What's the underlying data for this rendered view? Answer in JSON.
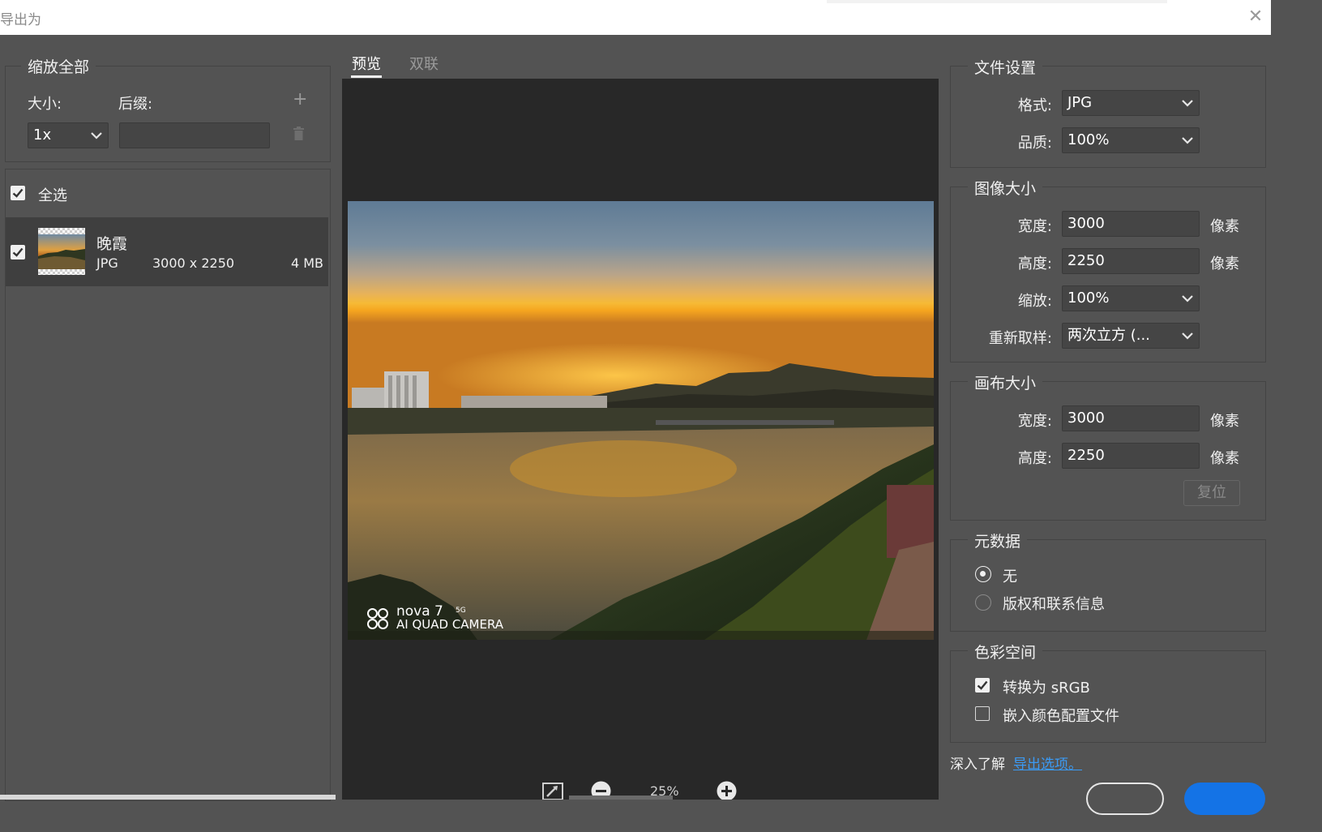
{
  "window": {
    "title": "导出为",
    "close_glyph": "✕"
  },
  "left": {
    "scale_all_title": "缩放全部",
    "size_label": "大小:",
    "suffix_label": "后缀:",
    "size_value": "1x",
    "suffix_value": "",
    "add_glyph": "+",
    "select_all_label": "全选",
    "assets": [
      {
        "name": "晚霞",
        "format": "JPG",
        "dimensions": "3000 x 2250",
        "filesize": "4 MB",
        "checked": true
      }
    ]
  },
  "center": {
    "tabs": [
      {
        "label": "预览",
        "active": true
      },
      {
        "label": "双联",
        "active": false
      }
    ],
    "watermark_line1": "nova 7",
    "watermark_sup": "5G",
    "watermark_line2": "AI QUAD CAMERA",
    "zoom_text": "25%"
  },
  "file_settings": {
    "title": "文件设置",
    "format_label": "格式:",
    "format_value": "JPG",
    "quality_label": "品质:",
    "quality_value": "100%"
  },
  "image_size": {
    "title": "图像大小",
    "width_label": "宽度:",
    "width_value": "3000",
    "height_label": "高度:",
    "height_value": "2250",
    "scale_label": "缩放:",
    "scale_value": "100%",
    "resample_label": "重新取样:",
    "resample_value": "两次立方 (...",
    "unit": "像素"
  },
  "canvas_size": {
    "title": "画布大小",
    "width_label": "宽度:",
    "width_value": "3000",
    "height_label": "高度:",
    "height_value": "2250",
    "unit": "像素",
    "reset_label": "复位"
  },
  "metadata": {
    "title": "元数据",
    "options": [
      {
        "label": "无",
        "selected": true
      },
      {
        "label": "版权和联系信息",
        "selected": false
      }
    ]
  },
  "color_space": {
    "title": "色彩空间",
    "convert_label": "转换为 sRGB",
    "convert_checked": true,
    "embed_label": "嵌入颜色配置文件",
    "embed_checked": false
  },
  "footer": {
    "learn_more_text": "深入了解",
    "learn_more_link": "导出选项。"
  },
  "colors": {
    "accent": "#1473e6",
    "link": "#3b9bf5",
    "panel": "#535353",
    "preview_bg": "#282828"
  }
}
